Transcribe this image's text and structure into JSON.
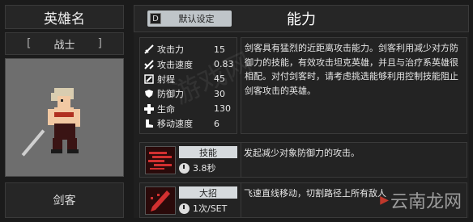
{
  "hero": {
    "title": "英雄名",
    "class_name": "战士",
    "bracket_left": "[",
    "bracket_right": "]",
    "hero_name": "剑客"
  },
  "header": {
    "preset_button": "默认设定",
    "preset_icon": "D",
    "title": "能力"
  },
  "stats": [
    {
      "icon": "sword-icon",
      "label": "攻击力",
      "value": "15"
    },
    {
      "icon": "attack-speed-icon",
      "label": "攻击速度",
      "value": "0.83"
    },
    {
      "icon": "range-icon",
      "label": "射程",
      "value": "45"
    },
    {
      "icon": "shield-icon",
      "label": "防御力",
      "value": "30"
    },
    {
      "icon": "health-cross-icon",
      "label": "生命",
      "value": "130"
    },
    {
      "icon": "boot-icon",
      "label": "移动速度",
      "value": "6"
    }
  ],
  "description": "剑客具有猛烈的近距离攻击能力。剑客利用减少对方防御力的技能，有效攻击坦克英雄，并且与治疗系英雄很相配。对付剑客时，请考虑挑选能够利用控制技能阻止剑客攻击的英雄。",
  "skills": [
    {
      "name": "技能",
      "cooldown": "3.8秒",
      "desc": "发起减少对象防御力的攻击。",
      "color": "#d23030"
    },
    {
      "name": "大招",
      "cooldown": "1次/SET",
      "desc": "飞速直线移动，切割路径上所有敌人",
      "color": "#d23030"
    }
  ],
  "watermark": {
    "text": "云南龙网",
    "faint": "游戏网"
  }
}
